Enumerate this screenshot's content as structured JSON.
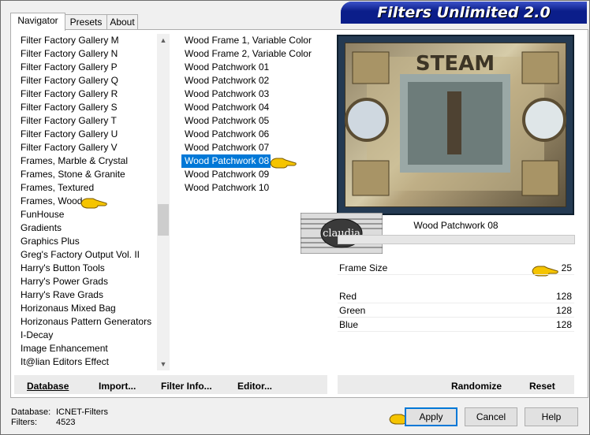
{
  "window": {
    "title": "Filters Unlimited 2.0"
  },
  "tabs": [
    "Navigator",
    "Presets",
    "About"
  ],
  "categories": [
    "Filter Factory Gallery M",
    "Filter Factory Gallery N",
    "Filter Factory Gallery P",
    "Filter Factory Gallery Q",
    "Filter Factory Gallery R",
    "Filter Factory Gallery S",
    "Filter Factory Gallery T",
    "Filter Factory Gallery U",
    "Filter Factory Gallery V",
    "Frames, Marble & Crystal",
    "Frames, Stone & Granite",
    "Frames, Textured",
    "Frames, Wood",
    "FunHouse",
    "Gradients",
    "Graphics Plus",
    "Greg's Factory Output Vol. II",
    "Harry's Button Tools",
    "Harry's Power Grads",
    "Harry's Rave Grads",
    "Horizonaus Mixed Bag",
    "Horizonaus Pattern Generators",
    "I-Decay",
    "Image Enhancement",
    "It@lian Editors Effect"
  ],
  "filters": [
    "Wood Frame 1, Variable Color",
    "Wood Frame 2, Variable Color",
    "Wood Patchwork 01",
    "Wood Patchwork 02",
    "Wood Patchwork 03",
    "Wood Patchwork 04",
    "Wood Patchwork 05",
    "Wood Patchwork 06",
    "Wood Patchwork 07",
    "Wood Patchwork 08",
    "Wood Patchwork 09",
    "Wood Patchwork 10"
  ],
  "selected_filter": "Wood Patchwork 08",
  "preview": {
    "image_text": "STEAM",
    "watermark": "claudia"
  },
  "params": [
    {
      "label": "Frame Size",
      "value": "25"
    },
    {
      "label": "Red",
      "value": "128"
    },
    {
      "label": "Green",
      "value": "128"
    },
    {
      "label": "Blue",
      "value": "128"
    }
  ],
  "toolbar": {
    "database": "Database",
    "import": "Import...",
    "filter_info": "Filter Info...",
    "editor": "Editor...",
    "randomize": "Randomize",
    "reset": "Reset"
  },
  "status": {
    "database_label": "Database:",
    "database_value": "ICNET-Filters",
    "filters_label": "Filters:",
    "filters_value": "4523"
  },
  "buttons": {
    "apply": "Apply",
    "cancel": "Cancel",
    "help": "Help"
  },
  "colors": {
    "selection": "#0078d7",
    "title_banner": "#0b1e8a",
    "pointer": "#f5c400"
  }
}
